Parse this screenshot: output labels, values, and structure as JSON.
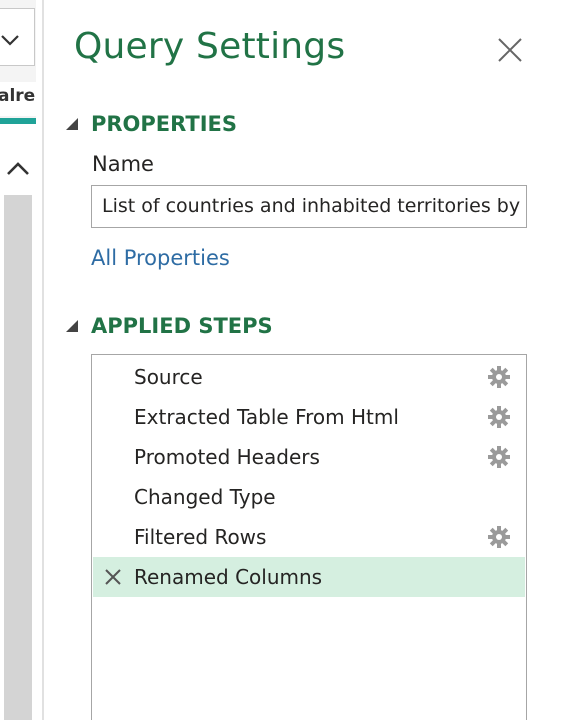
{
  "left_panel": {
    "column_header_text": "alreg"
  },
  "pane": {
    "title": "Query Settings"
  },
  "properties": {
    "heading": "PROPERTIES",
    "name_label": "Name",
    "name_value": "List of countries and inhabited territories by",
    "all_properties_link": "All Properties"
  },
  "applied_steps": {
    "heading": "APPLIED STEPS",
    "steps": [
      {
        "label": "Source",
        "has_settings": true,
        "selected": false
      },
      {
        "label": "Extracted Table From Html",
        "has_settings": true,
        "selected": false
      },
      {
        "label": "Promoted Headers",
        "has_settings": true,
        "selected": false
      },
      {
        "label": "Changed Type",
        "has_settings": false,
        "selected": false
      },
      {
        "label": "Filtered Rows",
        "has_settings": true,
        "selected": false
      },
      {
        "label": "Renamed Columns",
        "has_settings": false,
        "selected": true
      }
    ]
  },
  "colors": {
    "accent_green": "#217346",
    "link_blue": "#2e6ca4",
    "selected_row": "#d5efe0",
    "teal_accent": "#20a398"
  },
  "icons": [
    "chevron-down-icon",
    "chevron-up-icon",
    "close-icon",
    "collapse-triangle-icon",
    "gear-icon",
    "delete-step-icon"
  ]
}
